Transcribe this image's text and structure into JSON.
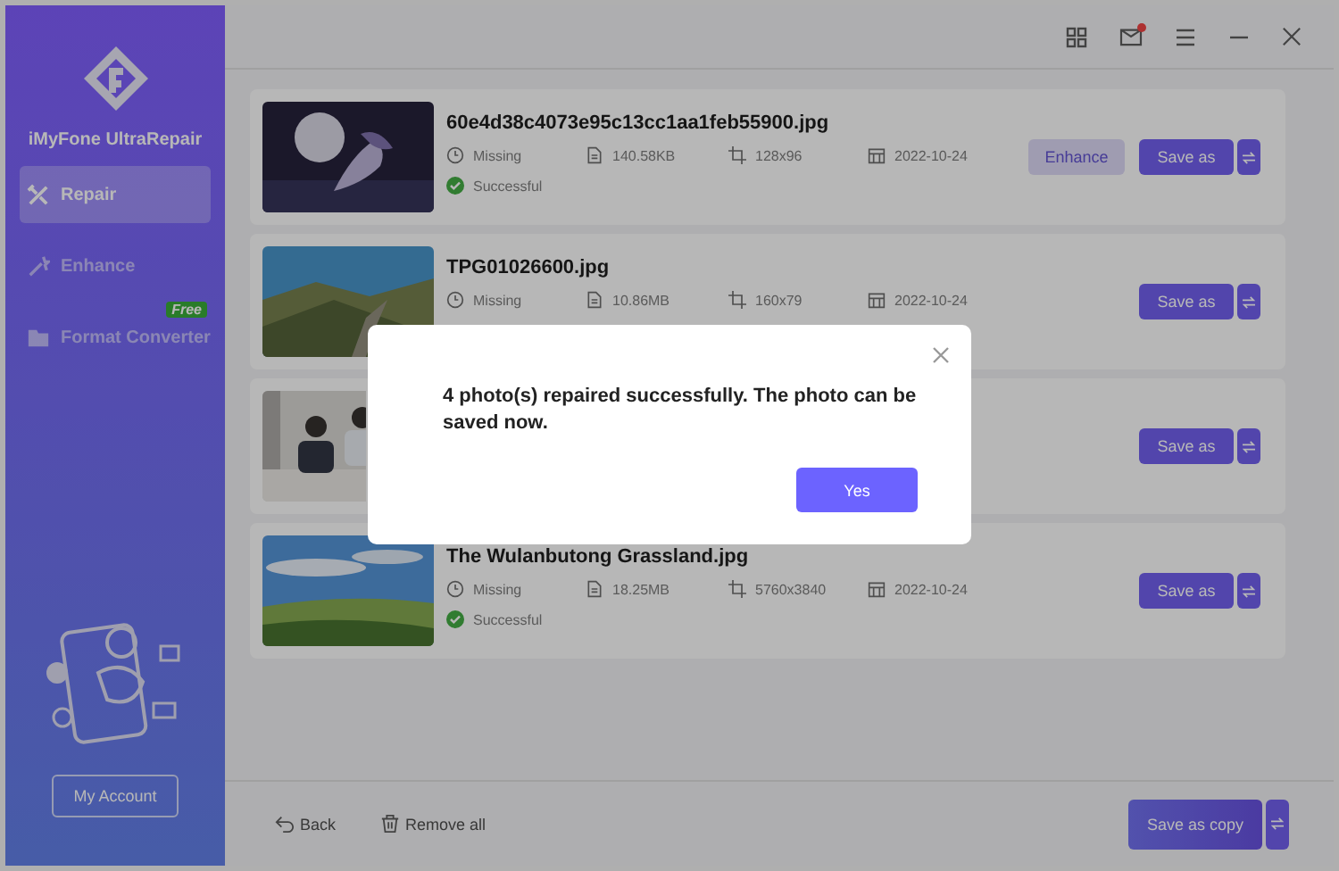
{
  "sidebar": {
    "app_name": "iMyFone UltraRepair",
    "items": [
      {
        "label": "Repair",
        "kind": "tools",
        "selected": true
      },
      {
        "label": "Enhance",
        "kind": "wand",
        "selected": false
      },
      {
        "label": "Format Converter",
        "kind": "folder",
        "selected": false,
        "badge": "Free"
      }
    ],
    "account_button": "My Account"
  },
  "titlebar": {
    "mail_unread": true
  },
  "files": [
    {
      "name": "60e4d38c4073e95c13cc1aa1feb55900.jpg",
      "meta": [
        {
          "kind": "clock",
          "text": "Missing"
        },
        {
          "kind": "file",
          "text": "140.58KB"
        },
        {
          "kind": "crop",
          "text": "128x96"
        },
        {
          "kind": "calendar",
          "text": "2022-10-24"
        }
      ],
      "status": "Successful",
      "enhance": "Enhance",
      "save": "Save as"
    },
    {
      "name": "TPG01026600.jpg",
      "meta": [
        {
          "kind": "clock",
          "text": "Missing"
        },
        {
          "kind": "file",
          "text": "10.86MB"
        },
        {
          "kind": "crop",
          "text": "160x79"
        },
        {
          "kind": "calendar",
          "text": "2022-10-24"
        }
      ],
      "save": "Save as"
    },
    {
      "save": "Save as"
    },
    {
      "name": "The Wulanbutong Grassland.jpg",
      "meta": [
        {
          "kind": "clock",
          "text": "Missing"
        },
        {
          "kind": "file",
          "text": "18.25MB"
        },
        {
          "kind": "crop",
          "text": "5760x3840"
        },
        {
          "kind": "calendar",
          "text": "2022-10-24"
        }
      ],
      "status": "Successful",
      "save": "Save as"
    }
  ],
  "footer": {
    "back": "Back",
    "remove_all": "Remove all",
    "save_copy": "Save as copy"
  },
  "dialog": {
    "message": "4 photo(s) repaired successfully. The photo can be saved now.",
    "button": "Yes"
  }
}
